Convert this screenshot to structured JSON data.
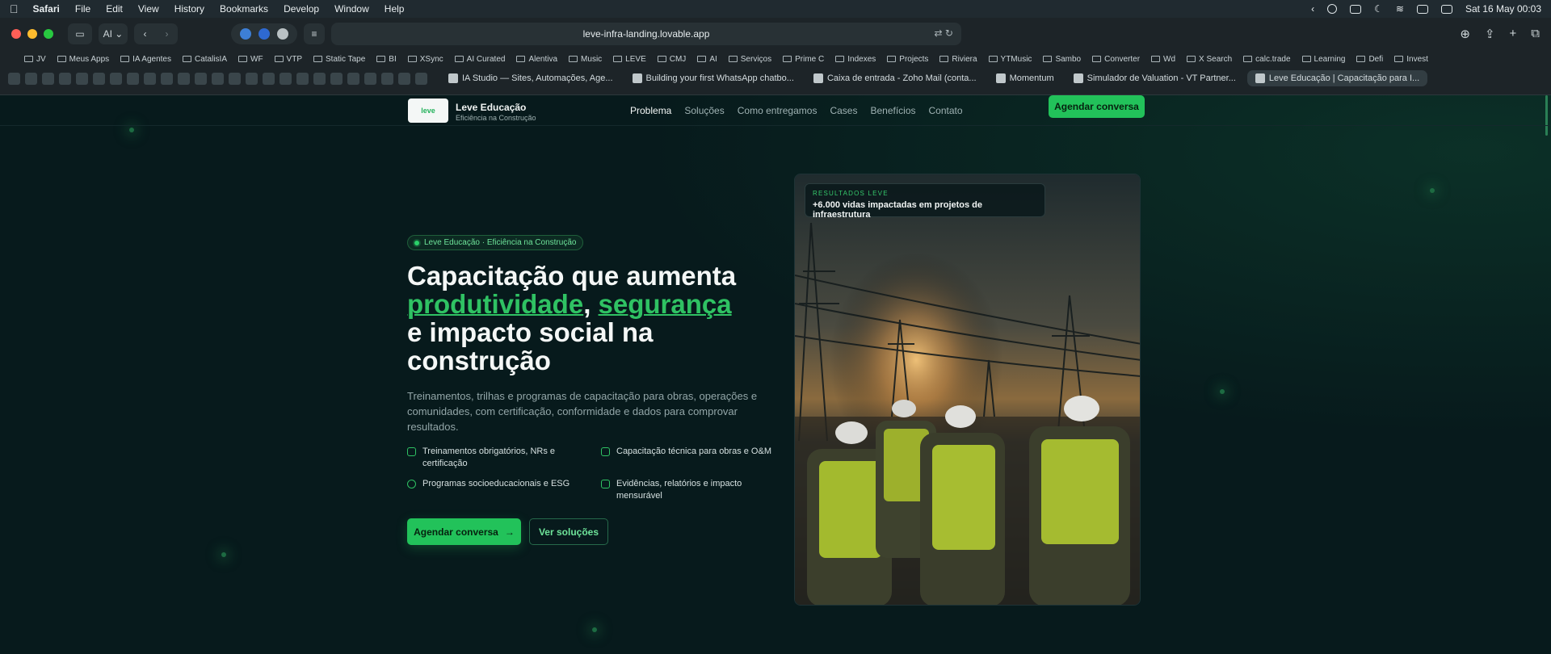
{
  "menubar": {
    "app": "Safari",
    "items": [
      "File",
      "Edit",
      "View",
      "History",
      "Bookmarks",
      "Develop",
      "Window",
      "Help"
    ],
    "clock": "Sat 16 May  00:03"
  },
  "browser": {
    "profile": "AI",
    "url": "leve-infra-landing.lovable.app",
    "bookmarks": [
      "JV",
      "Meus Apps",
      "IA Agentes",
      "CatalisIA",
      "WF",
      "VTP",
      "Static Tape",
      "BI",
      "XSync",
      "AI Curated",
      "Alentiva",
      "Music",
      "LEVE",
      "CMJ",
      "AI",
      "Serviços",
      "Prime C",
      "Indexes",
      "Projects",
      "Riviera",
      "YTMusic",
      "Sambo",
      "Converter",
      "Wd",
      "X Search",
      "calc.trade",
      "Learning",
      "Defi",
      "Invest"
    ],
    "tabs": [
      {
        "title": "IA Studio — Sites, Automações, Age...",
        "active": false
      },
      {
        "title": "Building your first WhatsApp chatbo...",
        "active": false
      },
      {
        "title": "Caixa de entrada - Zoho Mail (conta...",
        "active": false
      },
      {
        "title": "Momentum",
        "active": false
      },
      {
        "title": "Simulador de Valuation - VT Partner...",
        "active": false
      },
      {
        "title": "Leve Educação | Capacitação para I...",
        "active": true
      }
    ]
  },
  "site": {
    "logo_text": "leve",
    "brand_name": "Leve Educação",
    "brand_sub": "Eficiência na Construção",
    "nav": [
      "Problema",
      "Soluções",
      "Como entregamos",
      "Cases",
      "Benefícios",
      "Contato"
    ],
    "nav_cta": "Agendar conversa",
    "badge": "Leve Educação · Eficiência na Construção",
    "headline": {
      "p1": "Capacitação que aumenta ",
      "hl1": "produtividade",
      "p2": ", ",
      "hl2": "segurança",
      "p3": " e impacto social na construção"
    },
    "lead": "Treinamentos, trilhas e programas de capacitação para obras, operações e comunidades, com certificação, conformidade e dados para comprovar resultados.",
    "features": [
      "Treinamentos obrigatórios, NRs e certificação",
      "Capacitação técnica para obras e O&M",
      "Programas socioeducacionais e ESG",
      "Evidências, relatórios e impacto mensurável"
    ],
    "cta_primary": "Agendar conversa",
    "cta_primary_arrow": "→",
    "cta_secondary": "Ver soluções",
    "result_label": "RESULTADOS LEVE",
    "result_value": "+6.000 vidas impactadas em projetos de infraestrutura"
  },
  "colors": {
    "accent": "#22c25a",
    "background": "#071a1c"
  }
}
